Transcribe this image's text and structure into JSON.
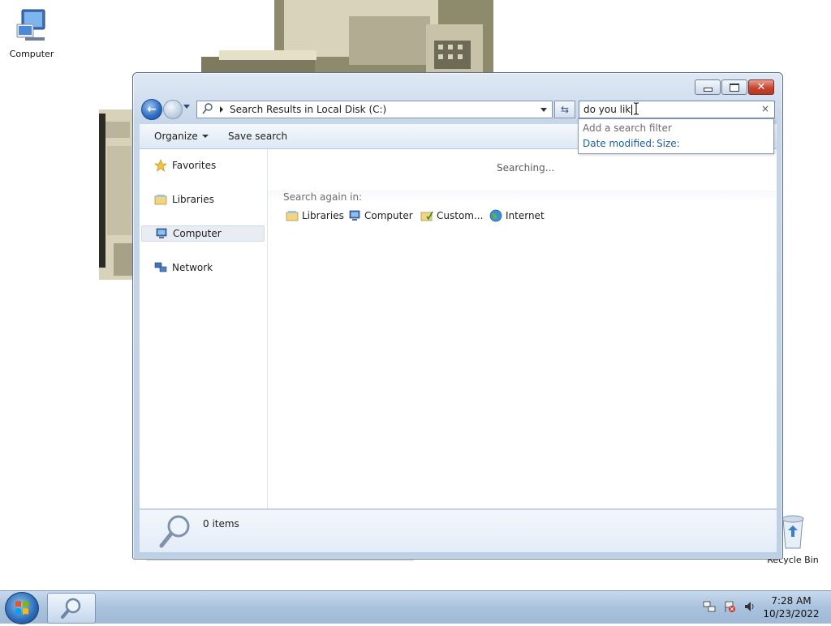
{
  "desktop": {
    "icons": [
      {
        "label": "Computer",
        "icon": "computer-icon"
      },
      {
        "label": "Recycle Bin",
        "icon": "recycle-bin-icon"
      }
    ]
  },
  "window": {
    "address": {
      "breadcrumb": "Search Results in Local Disk (C:)"
    },
    "search": {
      "value": "do you lik",
      "clear_label": "×",
      "filter_hint": "Add a search filter",
      "filters": [
        "Date modified:",
        "Size:"
      ]
    },
    "commands": {
      "organize": "Organize",
      "save_search": "Save search"
    },
    "nav": {
      "items": [
        {
          "label": "Favorites",
          "icon": "star-icon"
        },
        {
          "label": "Libraries",
          "icon": "libraries-icon"
        },
        {
          "label": "Computer",
          "icon": "computer-icon",
          "selected": true
        },
        {
          "label": "Network",
          "icon": "network-icon"
        }
      ]
    },
    "main": {
      "status": "Searching...",
      "search_again_label": "Search again in:",
      "search_again": [
        {
          "label": "Libraries",
          "icon": "libraries-icon"
        },
        {
          "label": "Computer",
          "icon": "computer-icon"
        },
        {
          "label": "Custom...",
          "icon": "custom-folder-icon"
        },
        {
          "label": "Internet",
          "icon": "globe-icon"
        }
      ]
    },
    "details": {
      "count": "0 items"
    }
  },
  "taskbar": {
    "time": "7:28 AM",
    "date": "10/23/2022",
    "colors": {
      "accent": "#2a6ab8"
    }
  }
}
